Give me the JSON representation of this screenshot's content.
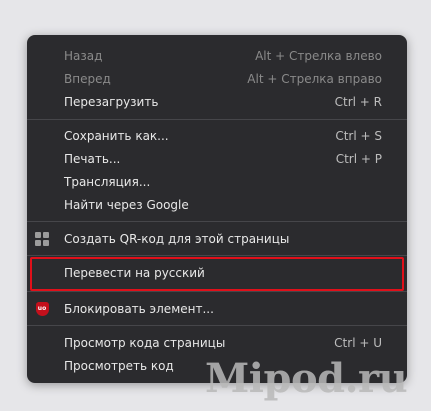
{
  "menu": {
    "back": {
      "label": "Назад",
      "shortcut": "Alt + Стрелка влево"
    },
    "forward": {
      "label": "Вперед",
      "shortcut": "Alt + Стрелка вправо"
    },
    "reload": {
      "label": "Перезагрузить",
      "shortcut": "Ctrl + R"
    },
    "save_as": {
      "label": "Сохранить как...",
      "shortcut": "Ctrl + S"
    },
    "print": {
      "label": "Печать...",
      "shortcut": "Ctrl + P"
    },
    "cast": {
      "label": "Трансляция..."
    },
    "search_google": {
      "label": "Найти через Google"
    },
    "qr_code": {
      "label": "Создать QR-код для этой страницы",
      "icon": "qr-code-icon"
    },
    "translate": {
      "label": "Перевести на русский"
    },
    "block_element": {
      "label": "Блокировать элемент...",
      "icon": "ublock-origin-icon",
      "icon_text": "uo",
      "icon_color": "#c4101c"
    },
    "view_source": {
      "label": "Просмотр кода страницы",
      "shortcut": "Ctrl + U"
    },
    "inspect": {
      "label": "Просмотреть код"
    }
  },
  "watermark": {
    "text": "Mipod.ru"
  },
  "colors": {
    "menu_bg": "#2b2b2e",
    "highlight": "#e0101a",
    "page_bg": "#e6e6e9"
  }
}
